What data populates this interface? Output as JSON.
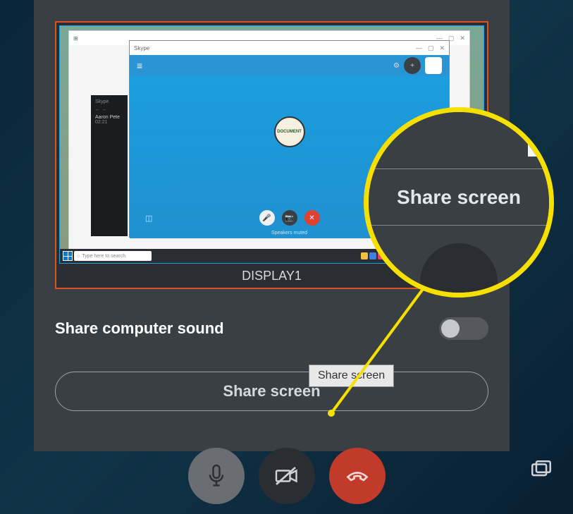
{
  "display": {
    "label": "DISPLAY1"
  },
  "preview": {
    "inner_app_title": "Skype",
    "sidebar": {
      "app_label": "Skype",
      "contact_name": "Aaron Pete",
      "contact_time": "02:21"
    },
    "center_avatar_text": "DOCUMENT",
    "speakers_status": "Speakers muted",
    "taskbar_search_placeholder": "Type here to search"
  },
  "sound_toggle": {
    "label": "Share computer sound",
    "enabled": false
  },
  "share_button_label": "Share screen",
  "tooltip_text": "Share screen",
  "magnifier_text": "Share screen",
  "icons": {
    "microphone": "microphone-icon",
    "camera_off": "camera-off-icon",
    "hangup": "hangup-icon",
    "share_screen": "share-screen-icon"
  }
}
